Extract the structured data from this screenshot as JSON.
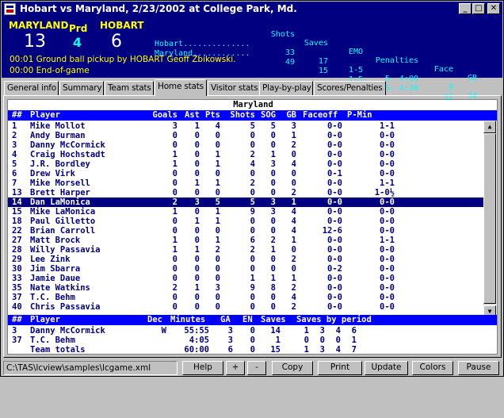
{
  "window": {
    "title": "Hobart vs Maryland, 2/23/2002 at College Park, Md.",
    "controls": {
      "minimize": "_",
      "maximize": "□",
      "close": "✕"
    }
  },
  "scoreboard": {
    "home_team": "MARYLAND",
    "home_score": "13",
    "period_label": "Prd",
    "period": "4",
    "visitor_team": "HOBART",
    "visitor_score": "6",
    "columns": [
      "Shots",
      "Saves",
      "EMO",
      "Penalties",
      "Face",
      "GB"
    ],
    "rows": [
      {
        "team": "Hobart..............",
        "shots": "33",
        "saves": "17",
        "emo": "1-5",
        "penalties": "5- 4:00",
        "face": "9",
        "gb": "34"
      },
      {
        "team": "Maryland............",
        "shots": "49",
        "saves": "15",
        "emo": "1-5",
        "penalties": "5- 4:30",
        "face": "12",
        "gb": "37"
      }
    ],
    "feed": [
      "00:01  Ground ball pickup by HOBART Geoff Zbikowski.",
      "00:00  End-of-game"
    ]
  },
  "tabs": [
    {
      "label": "General info",
      "active": false
    },
    {
      "label": "Summary",
      "active": false
    },
    {
      "label": "Team stats",
      "active": false
    },
    {
      "label": "Home stats",
      "active": true
    },
    {
      "label": "Visitor stats",
      "active": false
    },
    {
      "label": "Play-by-play",
      "active": false
    },
    {
      "label": "Scores/Penalties",
      "active": false
    }
  ],
  "grid": {
    "team": "Maryland",
    "player_headers": [
      "##",
      "Player",
      "Goals",
      "Ast",
      "Pts",
      "Shots",
      "SOG",
      "GB",
      "Faceoff",
      "P-Min"
    ],
    "players": [
      [
        "1",
        "Mike Mollot",
        "3",
        "1",
        "4",
        "5",
        "5",
        "3",
        "0-0",
        "1-1"
      ],
      [
        "2",
        "Andy Burman",
        "0",
        "0",
        "0",
        "0",
        "0",
        "1",
        "0-0",
        "0-0"
      ],
      [
        "3",
        "Danny McCormick",
        "0",
        "0",
        "0",
        "0",
        "0",
        "2",
        "0-0",
        "0-0"
      ],
      [
        "4",
        "Craig Hochstadt",
        "1",
        "0",
        "1",
        "2",
        "1",
        "0",
        "0-0",
        "0-0"
      ],
      [
        "5",
        "J.R. Bordley",
        "1",
        "0",
        "1",
        "4",
        "3",
        "4",
        "0-0",
        "0-0"
      ],
      [
        "6",
        "Drew Virk",
        "0",
        "0",
        "0",
        "0",
        "0",
        "0",
        "0-1",
        "0-0"
      ],
      [
        "7",
        "Mike Morsell",
        "0",
        "1",
        "1",
        "2",
        "0",
        "0",
        "0-0",
        "1-1"
      ],
      [
        "13",
        "Brett Harper",
        "0",
        "0",
        "0",
        "0",
        "0",
        "2",
        "0-0",
        "1-0½"
      ],
      [
        "14",
        "Dan LaMonica",
        "2",
        "3",
        "5",
        "5",
        "3",
        "1",
        "0-0",
        "0-0"
      ],
      [
        "15",
        "Mike LaMonica",
        "1",
        "0",
        "1",
        "9",
        "3",
        "4",
        "0-0",
        "0-0"
      ],
      [
        "18",
        "Paul Gilletto",
        "0",
        "1",
        "1",
        "0",
        "0",
        "4",
        "0-0",
        "0-0"
      ],
      [
        "22",
        "Brian Carroll",
        "0",
        "0",
        "0",
        "0",
        "0",
        "4",
        "12-6",
        "0-0"
      ],
      [
        "27",
        "Matt Brock",
        "1",
        "0",
        "1",
        "6",
        "2",
        "1",
        "0-0",
        "1-1"
      ],
      [
        "28",
        "Willy Passavia",
        "1",
        "1",
        "2",
        "2",
        "1",
        "0",
        "0-0",
        "0-0"
      ],
      [
        "29",
        "Lee Zink",
        "0",
        "0",
        "0",
        "0",
        "0",
        "2",
        "0-0",
        "0-0"
      ],
      [
        "30",
        "Jim Sbarra",
        "0",
        "0",
        "0",
        "0",
        "0",
        "0",
        "0-2",
        "0-0"
      ],
      [
        "33",
        "Jamie Daue",
        "0",
        "0",
        "0",
        "1",
        "1",
        "1",
        "0-0",
        "0-0"
      ],
      [
        "35",
        "Nate Watkins",
        "2",
        "1",
        "3",
        "9",
        "8",
        "2",
        "0-0",
        "0-0"
      ],
      [
        "37",
        "T.C. Behm",
        "0",
        "0",
        "0",
        "0",
        "0",
        "4",
        "0-0",
        "0-0"
      ],
      [
        "40",
        "Chris Passavia",
        "0",
        "0",
        "0",
        "0",
        "0",
        "2",
        "0-0",
        "0-0"
      ]
    ],
    "goalie_headers": [
      "##",
      "Player",
      "Dec",
      "Minutes",
      "GA",
      "EN",
      "Saves",
      "Saves by period"
    ],
    "goalies": [
      {
        "num": "3",
        "name": "Danny McCormick",
        "dec": "W",
        "min": "55:55",
        "ga": "3",
        "en": "0",
        "saves": "14",
        "p1": "1",
        "p2": "3",
        "p3": "4",
        "p4": "6"
      },
      {
        "num": "37",
        "name": "T.C. Behm",
        "dec": "",
        "min": "4:05",
        "ga": "3",
        "en": "0",
        "saves": "1",
        "p1": "0",
        "p2": "0",
        "p3": "0",
        "p4": "1"
      },
      {
        "num": "",
        "name": "Team totals",
        "dec": "",
        "min": "60:00",
        "ga": "6",
        "en": "0",
        "saves": "15",
        "p1": "1",
        "p2": "3",
        "p3": "4",
        "p4": "7"
      }
    ]
  },
  "statusbar": {
    "path": "C:\\TAS\\lcview\\samples\\lcgame.xml",
    "buttons": [
      "Help",
      "+",
      "-",
      "Copy",
      "Print",
      "Update",
      "Colors",
      "Pause"
    ]
  }
}
